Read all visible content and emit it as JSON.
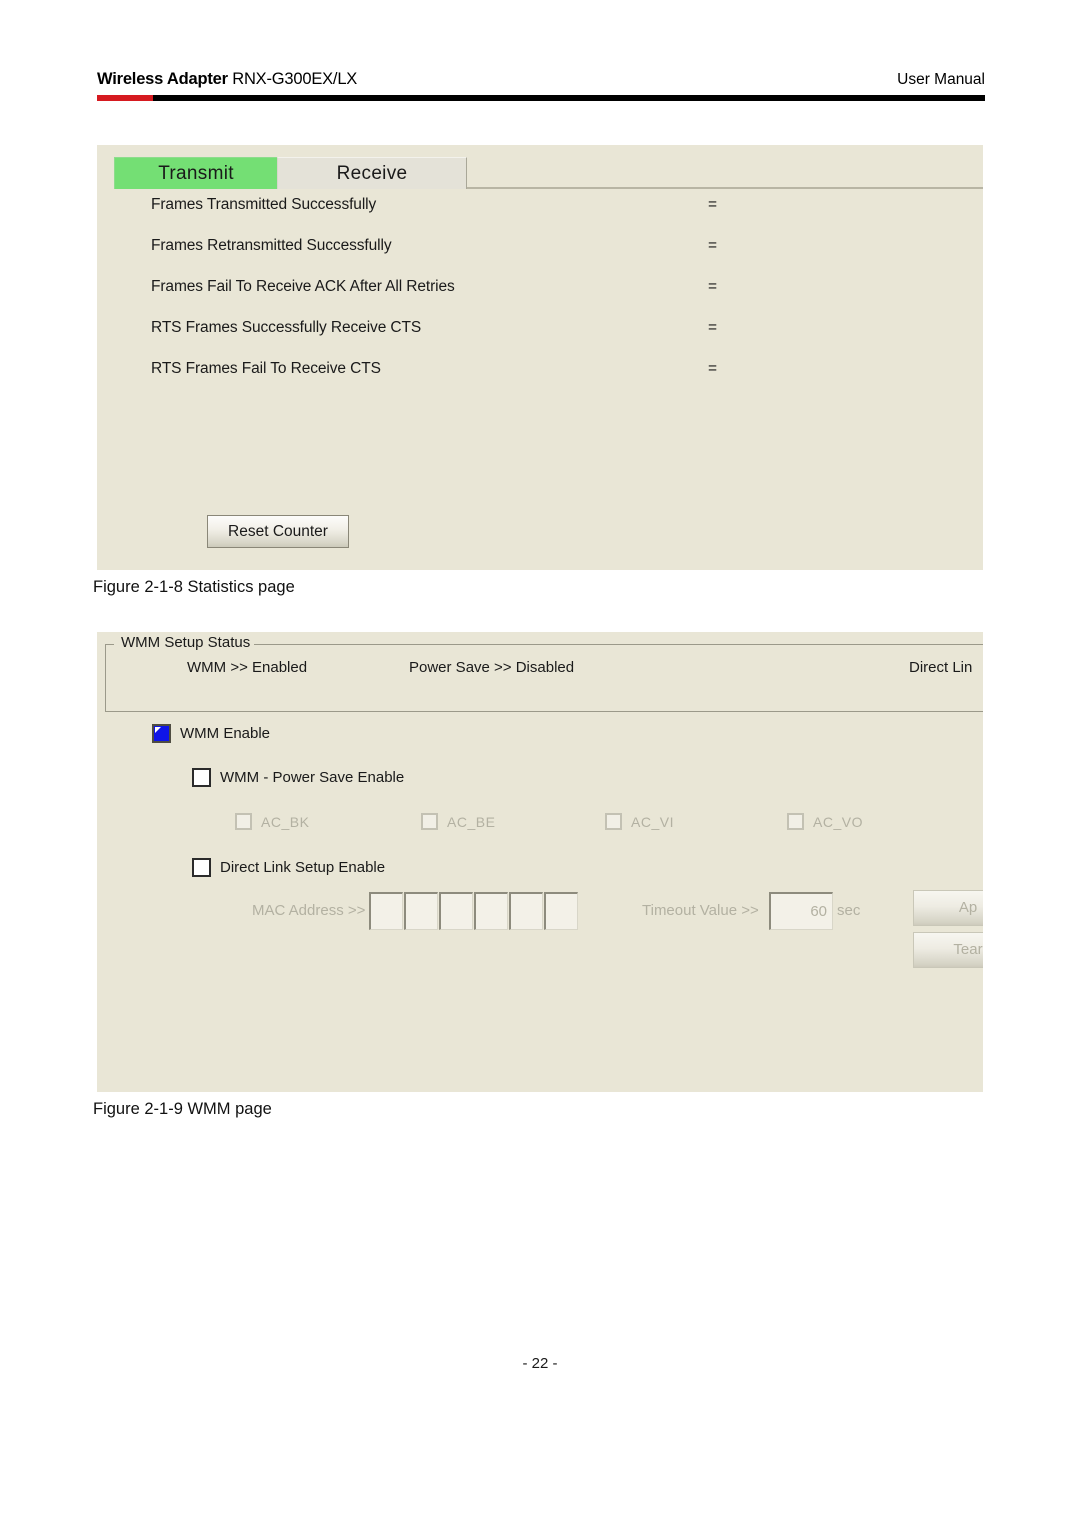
{
  "header": {
    "product_bold": "Wireless Adapter",
    "product_model": " RNX-G300EX/LX",
    "doc_type": "User Manual",
    "rule_color": "#000000",
    "accent_color": "#d61a20"
  },
  "statistics_panel": {
    "tabs": [
      {
        "label": "Transmit",
        "active": true,
        "color": "#74df74"
      },
      {
        "label": "Receive",
        "active": false,
        "color": "#e4e2d8"
      }
    ],
    "rows": [
      {
        "label": "Frames Transmitted Successfully",
        "separator": "=",
        "value": ""
      },
      {
        "label": "Frames Retransmitted Successfully",
        "separator": "=",
        "value": ""
      },
      {
        "label": "Frames Fail To Receive ACK After All Retries",
        "separator": "=",
        "value": ""
      },
      {
        "label": "RTS Frames Successfully Receive CTS",
        "separator": "=",
        "value": ""
      },
      {
        "label": "RTS Frames Fail To Receive CTS",
        "separator": "=",
        "value": ""
      }
    ],
    "reset_button_label": "Reset Counter"
  },
  "caption_statistics": "Figure 2-1-8 Statistics page",
  "wmm_panel": {
    "fieldset_legend": "WMM Setup Status",
    "status": {
      "wmm": "WMM >>  Enabled",
      "power_save": "Power Save >>  Disabled",
      "direct_link": "Direct Lin"
    },
    "checkboxes": {
      "wmm_enable": {
        "label": "WMM Enable",
        "checked": true,
        "disabled": false
      },
      "power_save_enable": {
        "label": "WMM - Power Save Enable",
        "checked": false,
        "disabled": false
      },
      "direct_link_enable": {
        "label": "Direct Link Setup Enable",
        "checked": false,
        "disabled": false
      }
    },
    "access_categories": [
      {
        "label": "AC_BK",
        "checked": false,
        "disabled": true
      },
      {
        "label": "AC_BE",
        "checked": false,
        "disabled": true
      },
      {
        "label": "AC_VI",
        "checked": false,
        "disabled": true
      },
      {
        "label": "AC_VO",
        "checked": false,
        "disabled": true
      }
    ],
    "mac_address": {
      "label": "MAC Address >>",
      "octets": [
        "",
        "",
        "",
        "",
        "",
        ""
      ]
    },
    "timeout": {
      "label": "Timeout Value >>",
      "value": "60",
      "unit": "sec"
    },
    "buttons": {
      "apply": "Ap",
      "tear_down": "Tear"
    }
  },
  "caption_wmm": "Figure 2-1-9 WMM page",
  "page_number": "- 22 -"
}
